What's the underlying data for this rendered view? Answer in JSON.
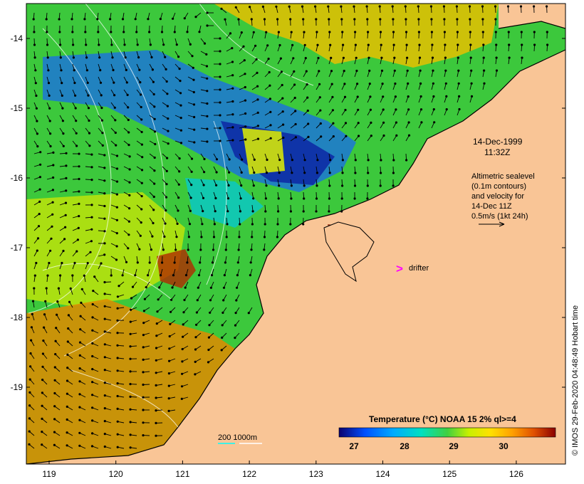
{
  "map": {
    "date_label": "14-Dec-1999",
    "time_label": "11:32Z",
    "altimetry_lines": [
      "Altimetric sealevel",
      "(0.1m contours)",
      "and velocity for",
      "14-Dec 11Z",
      "0.5m/s (1kt 24h)"
    ],
    "drifter_label": "drifter",
    "drifter_glyph": ">",
    "depth_label": "200  1000m",
    "credit": "© IMOS 29-Feb-2020 04:48:49 Hobart time",
    "colorbar_title": "Temperature (°C) NOAA 15 2% ql>=4",
    "colorbar_ticks": [
      "27",
      "28",
      "29",
      "30"
    ],
    "x_ticks": [
      "119",
      "120",
      "121",
      "122",
      "123",
      "124",
      "125",
      "126"
    ],
    "y_ticks": [
      "-14",
      "-15",
      "-16",
      "-17",
      "-18",
      "-19"
    ],
    "colors": {
      "land": "#f9c596",
      "drifter": "#ff00ff",
      "isobath_200": "#00ffff",
      "isobath_1000": "#ffffff",
      "arrow": "#000000"
    }
  }
}
